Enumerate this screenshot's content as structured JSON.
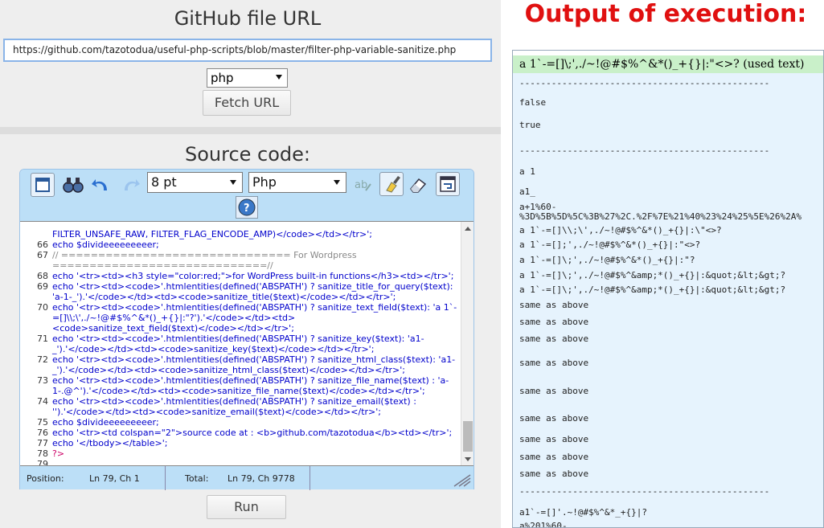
{
  "url_section": {
    "title": "GitHub file URL",
    "url_value": "https://github.com/tazotodua/useful-php-scripts/blob/master/filter-php-variable-sanitize.php",
    "language": "php",
    "fetch_label": "Fetch URL"
  },
  "source_section": {
    "title": "Source code:",
    "font_size": "8 pt",
    "syntax": "Php",
    "run_label": "Run"
  },
  "code_lines": [
    {
      "n": "",
      "t": "FILTER_UNSAFE_RAW, FILTER_FLAG_ENCODE_AMP)</code></td></tr>';"
    },
    {
      "n": "66",
      "t": "echo $divideeeeeeeeer;"
    },
    {
      "n": "67",
      "t": "// =============================== For Wordpress"
    },
    {
      "n": "",
      "t": "=============================//"
    },
    {
      "n": "68",
      "t": "echo '<tr><td><h3 style=\"color:red;\">for WordPress built-in functions</h3><td></tr>';"
    },
    {
      "n": "69",
      "t": "echo '<tr><td><code>'.htmlentities(defined('ABSPATH') ? sanitize_title_for_query($text):"
    },
    {
      "n": "",
      "t": "'a-1-_').'</code></td><td><code>sanitize_title($text)</code></td></tr>';"
    },
    {
      "n": "70",
      "t": "echo '<tr><td><code>'.htmlentities(defined('ABSPATH') ? sanitize_text_field($text): 'a 1`-"
    },
    {
      "n": "",
      "t": "=[]\\\\;\\',./~!@#$%^&*()_+{}|:\"?').'</code></td><td>"
    },
    {
      "n": "",
      "t": "<code>sanitize_text_field($text)</code></td></tr>';"
    },
    {
      "n": "71",
      "t": "echo '<tr><td><code>'.htmlentities(defined('ABSPATH') ? sanitize_key($text): 'a1-"
    },
    {
      "n": "",
      "t": "_').'</code></td><td><code>sanitize_key($text)</code></td></tr>';"
    },
    {
      "n": "72",
      "t": "echo '<tr><td><code>'.htmlentities(defined('ABSPATH') ? sanitize_html_class($text): 'a1-"
    },
    {
      "n": "",
      "t": "_').'</code></td><td><code>sanitize_html_class($text)</code></td></tr>';"
    },
    {
      "n": "73",
      "t": "echo '<tr><td><code>'.htmlentities(defined('ABSPATH') ? sanitize_file_name($text) : 'a-"
    },
    {
      "n": "",
      "t": "1-.@^').'</code></td><td><code>sanitize_file_name($text)</code></td></tr>';"
    },
    {
      "n": "74",
      "t": "echo '<tr><td><code>'.htmlentities(defined('ABSPATH') ? sanitize_email($text) :"
    },
    {
      "n": "",
      "t": "'').'</code></td><td><code>sanitize_email($text)</code></td></tr>';"
    },
    {
      "n": "75",
      "t": "echo $divideeeeeeeeer;"
    },
    {
      "n": "76",
      "t": "echo '<tr><td colspan=\"2\">source code at : <b>github.com/tazotodua</b><td></tr>';"
    },
    {
      "n": "77",
      "t": "echo '</tbody></table>';"
    },
    {
      "n": "78",
      "t": "?>"
    },
    {
      "n": "79",
      "t": ""
    }
  ],
  "status_bar": {
    "position_label": "Position:",
    "position_value": "Ln 79, Ch 1",
    "total_label": "Total:",
    "total_value": "Ln 79, Ch 9778"
  },
  "output_section": {
    "title": "Output of execution:",
    "header_line": "a 1`-=[]\\;',./~!@#$%^&*()_+{}|:\"<>? (used text)",
    "lines": [
      "-----------------------------------------------",
      "false",
      "true",
      "-----------------------------------------------",
      "a 1",
      "a1_",
      "a+1%60-",
      "%3D%5B%5D%5C%3B%27%2C.%2F%7E%21%40%23%24%25%5E%26%2A%",
      "a 1`-=[]\\\\;\\',./~!@#$%^&*()_+{}|:\\\"<>?",
      "a 1`-=[];',./~!@#$%^&*()_+{}|:\"<>?",
      "a 1`-=[]\\;',./~!@#$%^&*()_+{}|:\"?",
      "a 1`-=[]\\;',./~!@#$%^&amp;*()_+{}|:&quot;&lt;&gt;?",
      "a 1`-=[]\\;',./~!@#$%^&amp;*()_+{}|:&quot;&lt;&gt;?",
      "same as above",
      "same as above",
      "same as above",
      "same as above",
      "same as above",
      "same as above",
      "same as above",
      "same as above",
      "same as above",
      "-----------------------------------------------",
      "a1`-=[]'.~!@#$%^&*_+{}|?",
      "a%201%60-"
    ]
  }
}
